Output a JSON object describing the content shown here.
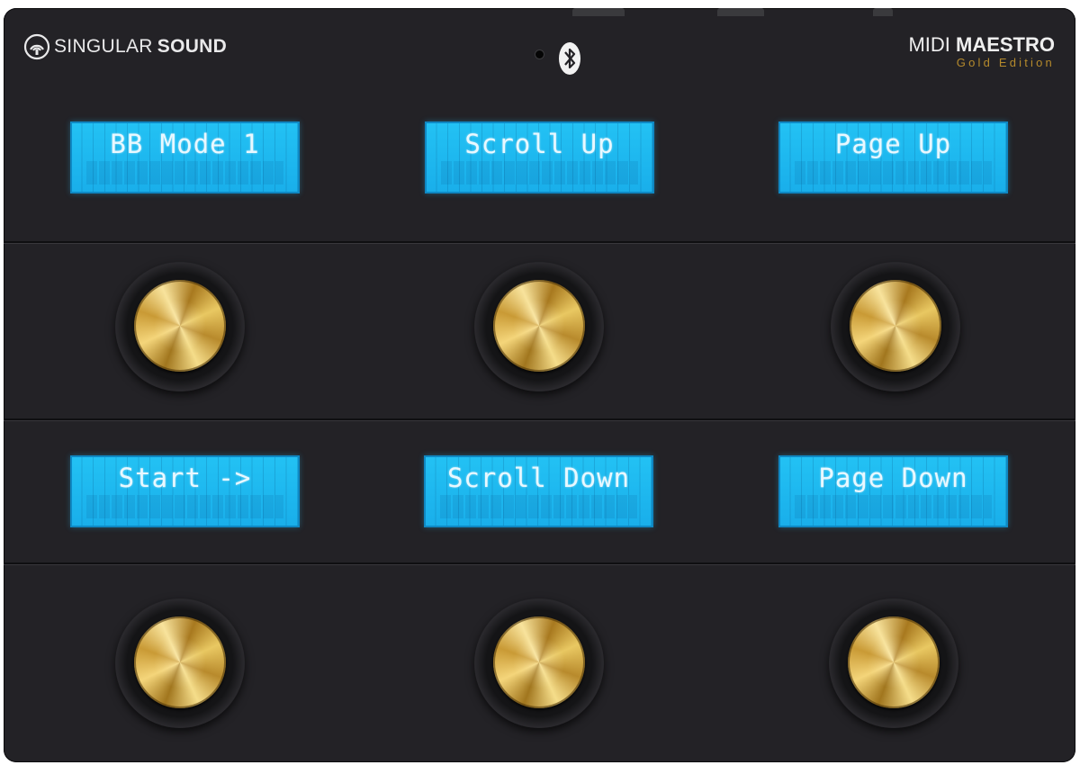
{
  "brand": {
    "part1": "SINGULAR",
    "part2": "SOUND",
    "logo_icon": "singular-sound-logo-icon"
  },
  "model": {
    "part1": "MIDI ",
    "part2": "MAESTRO",
    "edition": "Gold Edition"
  },
  "status": {
    "bluetooth_icon": "bluetooth-icon",
    "led_icon": "status-led-icon"
  },
  "screens": [
    {
      "label": "BB Mode 1"
    },
    {
      "label": "Scroll Up"
    },
    {
      "label": "Page Up"
    },
    {
      "label": "Start ->"
    },
    {
      "label": "Scroll Down"
    },
    {
      "label": "Page Down"
    }
  ],
  "colors": {
    "chassis": "#232226",
    "lcd": "#1fb8ee",
    "gold": "#d9b14e",
    "edition_text": "#b58a2c"
  }
}
